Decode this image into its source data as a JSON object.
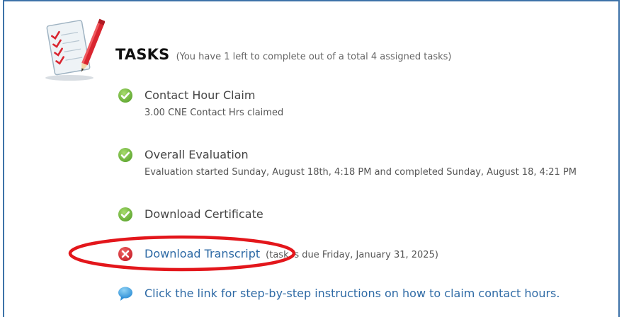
{
  "tasks_header": {
    "title": "TASKS",
    "summary": "(You have 1 left to complete out of a total 4 assigned tasks)"
  },
  "tasks": [
    {
      "title": "Contact Hour Claim",
      "detail": "3.00 CNE Contact Hrs claimed",
      "status": "complete"
    },
    {
      "title": "Overall Evaluation",
      "detail": "Evaluation started Sunday, August 18th, 4:18 PM and completed Sunday, August 18, 4:21 PM",
      "status": "complete"
    },
    {
      "title": "Download Certificate",
      "status": "complete"
    },
    {
      "title": "Download Transcript",
      "note": "(task is due Friday, January 31, 2025)",
      "status": "incomplete"
    }
  ],
  "help_link": {
    "text": "Click the link for step-by-step instructions on how to claim contact hours."
  },
  "colors": {
    "frame_border": "#3d72a8",
    "link": "#2e6aa5",
    "complete_green": "#6cb33f",
    "incomplete_red": "#d9252f",
    "annotation_red": "#e3161b",
    "info_blue": "#3aa3e3"
  }
}
